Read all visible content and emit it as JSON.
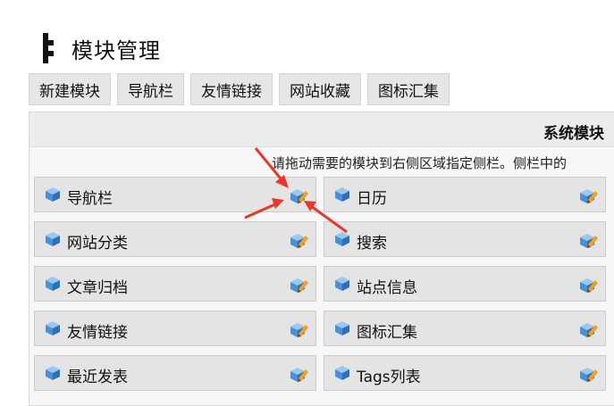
{
  "page": {
    "title": "模块管理"
  },
  "tabs": [
    "新建模块",
    "导航栏",
    "友情链接",
    "网站收藏",
    "图标汇集"
  ],
  "panel": {
    "title": "系统模块",
    "hint": "请拖动需要的模块到右侧区域指定侧栏。侧栏中的"
  },
  "modules": {
    "left": [
      "导航栏",
      "网站分类",
      "文章归档",
      "友情链接",
      "最近发表"
    ],
    "right": [
      "日历",
      "搜索",
      "站点信息",
      "图标汇集",
      "Tags列表"
    ]
  },
  "colors": {
    "arrow": "#e8372c",
    "cube_blue": "#4a90d9",
    "pencil": "#f0a020"
  }
}
